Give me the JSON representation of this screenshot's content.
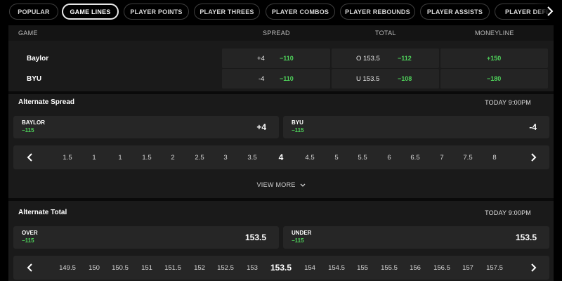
{
  "tabs": [
    {
      "label": "POPULAR",
      "active": false
    },
    {
      "label": "GAME LINES",
      "active": true
    },
    {
      "label": "PLAYER POINTS",
      "active": false
    },
    {
      "label": "PLAYER THREES",
      "active": false
    },
    {
      "label": "PLAYER COMBOS",
      "active": false
    },
    {
      "label": "PLAYER REBOUNDS",
      "active": false
    },
    {
      "label": "PLAYER ASSISTS",
      "active": false
    },
    {
      "label": "PLAYER DEFENSE",
      "active": false
    }
  ],
  "game_lines": {
    "headers": {
      "game": "GAME",
      "spread": "SPREAD",
      "total": "TOTAL",
      "moneyline": "MONEYLINE"
    },
    "rows": [
      {
        "team": "Baylor",
        "spread_line": "+4",
        "spread_odds": "−110",
        "total_line": "O 153.5",
        "total_odds": "−112",
        "moneyline": "+150"
      },
      {
        "team": "BYU",
        "spread_line": "-4",
        "spread_odds": "−110",
        "total_line": "U 153.5",
        "total_odds": "−108",
        "moneyline": "−180"
      }
    ]
  },
  "alt_spread": {
    "title": "Alternate Spread",
    "time": "TODAY 9:00PM",
    "left": {
      "name": "BAYLOR",
      "odds": "−115",
      "value": "+4"
    },
    "right": {
      "name": "BYU",
      "odds": "−115",
      "value": "-4"
    },
    "options": [
      "1.5",
      "1",
      "1",
      "1.5",
      "2",
      "2.5",
      "3",
      "3.5",
      "4",
      "4.5",
      "5",
      "5.5",
      "6",
      "6.5",
      "7",
      "7.5",
      "8"
    ],
    "selected": "4",
    "view_more": "VIEW MORE"
  },
  "alt_total": {
    "title": "Alternate Total",
    "time": "TODAY 9:00PM",
    "left": {
      "name": "OVER",
      "odds": "−115",
      "value": "153.5"
    },
    "right": {
      "name": "UNDER",
      "odds": "−115",
      "value": "153.5"
    },
    "options": [
      "149.5",
      "150",
      "150.5",
      "151",
      "151.5",
      "152",
      "152.5",
      "153",
      "153.5",
      "154",
      "154.5",
      "155",
      "155.5",
      "156",
      "156.5",
      "157",
      "157.5"
    ],
    "selected": "153.5"
  },
  "icons": {
    "prev": "chevron-left-icon",
    "next": "chevron-right-icon",
    "expand": "chevron-down-icon"
  },
  "colors": {
    "odds": "#4fd45b",
    "panel": "#1a1a1a",
    "cell": "#242424"
  }
}
